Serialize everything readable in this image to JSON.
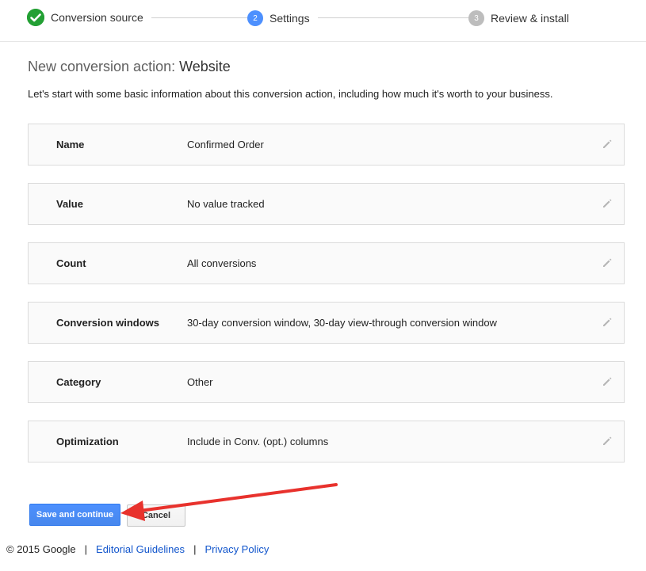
{
  "stepper": {
    "steps": [
      {
        "label": "Conversion source",
        "badge": "✓",
        "state": "done"
      },
      {
        "label": "Settings",
        "badge": "2",
        "state": "current"
      },
      {
        "label": "Review & install",
        "badge": "3",
        "state": "upcoming"
      }
    ]
  },
  "header": {
    "title_prefix": "New conversion action: ",
    "title_strong": "Website",
    "intro": "Let's start with some basic information about this conversion action, including how much it's worth to your business."
  },
  "settings": {
    "rows": [
      {
        "label": "Name",
        "value": "Confirmed Order"
      },
      {
        "label": "Value",
        "value": "No value tracked"
      },
      {
        "label": "Count",
        "value": "All conversions"
      },
      {
        "label": "Conversion windows",
        "value": "30-day conversion window, 30-day view-through conversion window"
      },
      {
        "label": "Category",
        "value": "Other"
      },
      {
        "label": "Optimization",
        "value": "Include in Conv. (opt.) columns"
      }
    ],
    "edit_icon": "pencil-icon"
  },
  "actions": {
    "save_label": "Save and continue",
    "cancel_label": "Cancel"
  },
  "footer": {
    "copyright": "© 2015 Google",
    "separator": "|",
    "links": [
      "Editorial Guidelines",
      "Privacy Policy"
    ]
  },
  "colors": {
    "done": "#23a034",
    "current": "#4d90fe",
    "upcoming": "#bdbdbd",
    "primary_button": "#4d90fe",
    "link": "#1155cc",
    "annotation_arrow": "#e8322d"
  }
}
